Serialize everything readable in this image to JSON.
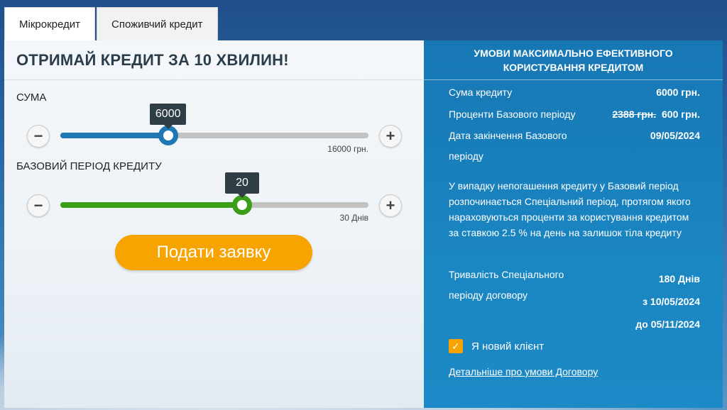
{
  "tabs": [
    {
      "label": "Мікрокредит",
      "active": true
    },
    {
      "label": "Споживчий кредит",
      "active": false
    }
  ],
  "left": {
    "title": "ОТРИМАЙ КРЕДИТ ЗА 10 ХВИЛИН!",
    "amount": {
      "label": "СУМА",
      "value": "6000",
      "max_label": "16000 грн.",
      "fill_fraction": 0.35,
      "color": "#1f77b4"
    },
    "period": {
      "label": "БАЗОВИЙ ПЕРІОД КРЕДИТУ",
      "value": "20",
      "max_label": "30 Днів",
      "fill_fraction": 0.59,
      "color": "#3a9e18"
    },
    "minus_icon": "minus-icon",
    "plus_icon": "plus-icon",
    "apply_label": "Подати заявку"
  },
  "right": {
    "title": "УМОВИ МАКСИМАЛЬНО ЕФЕКТИВНОГО КОРИСТУВАННЯ КРЕДИТОМ",
    "amount_label": "Сума кредиту",
    "amount_value": "6000 грн.",
    "interest_label": "Проценти Базового періоду",
    "interest_old": "2388 грн.",
    "interest_new": "600 грн.",
    "end_date_label": "Дата закінчення Базового періоду",
    "end_date_value": "09/05/2024",
    "notice": "У випадку непогашення кредиту у Базовий період розпочинається Спеціальний період, протягом якого нараховуються проценти за користування кредитом за ставкою 2.5 % на день на залишок тіла кредиту",
    "special_label": "Тривалість Спеціального періоду договору",
    "special_days": "180 Днів",
    "special_from": "з 10/05/2024",
    "special_to": "до 05/11/2024",
    "new_client_label": "Я новий клієнт",
    "new_client_checked": true,
    "details_link": "Детальніше про умови Договору",
    "accent": "#f7a300"
  }
}
